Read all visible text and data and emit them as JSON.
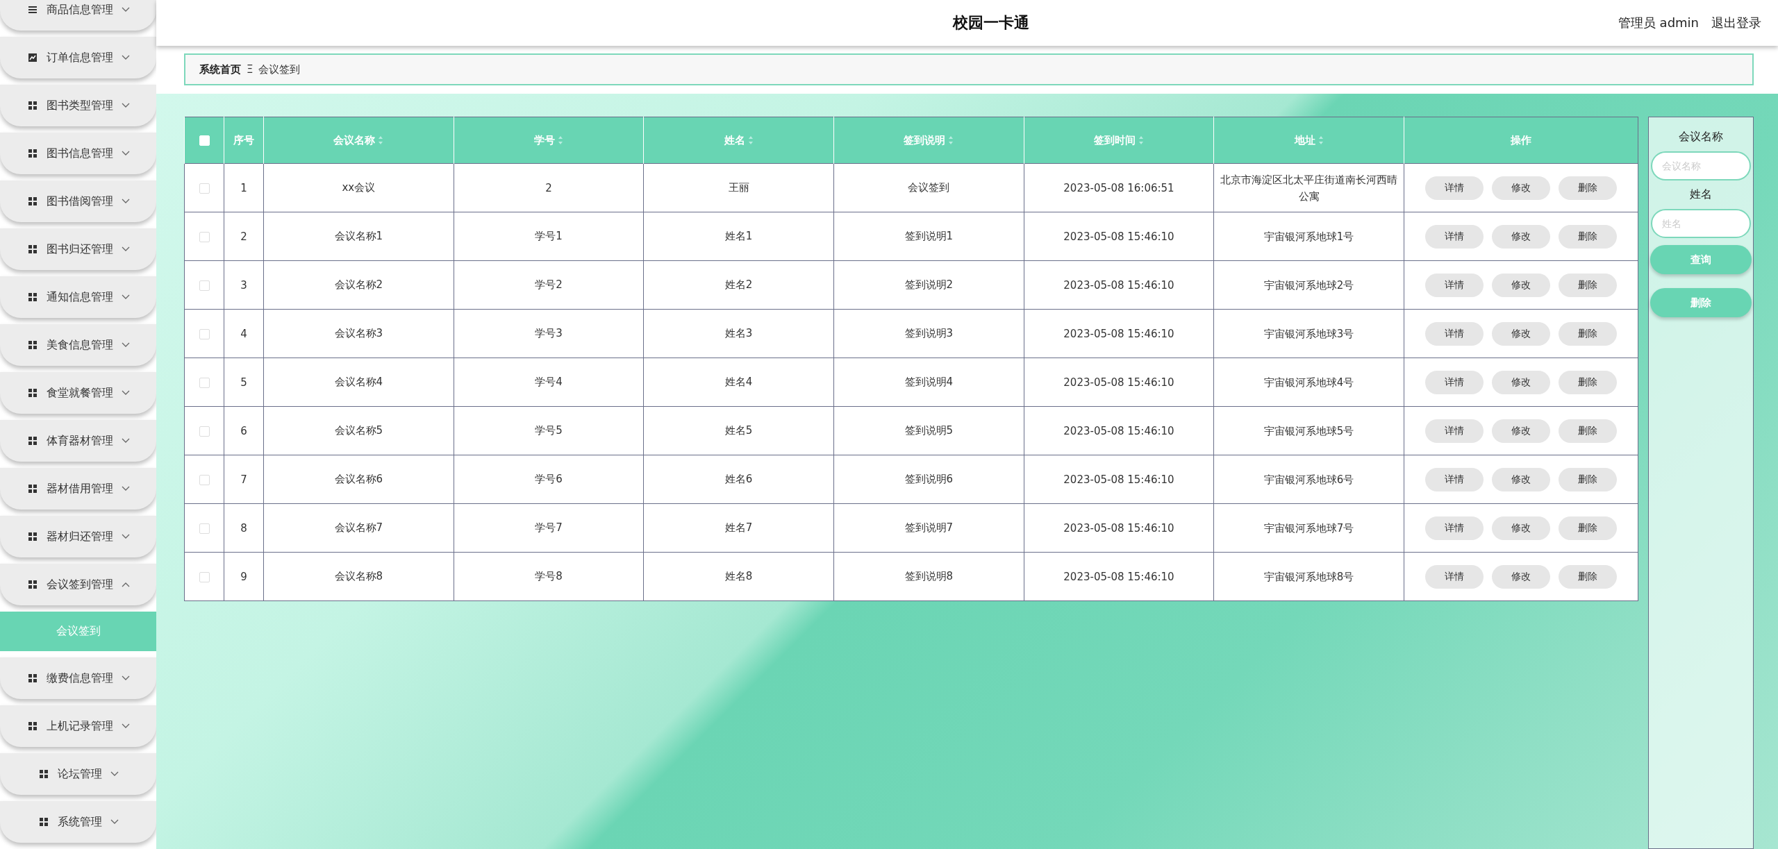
{
  "sidebar": {
    "items": [
      {
        "label": "商品信息管理",
        "expanded": false
      },
      {
        "label": "订单信息管理",
        "expanded": false
      },
      {
        "label": "图书类型管理",
        "expanded": false
      },
      {
        "label": "图书信息管理",
        "expanded": false
      },
      {
        "label": "图书借阅管理",
        "expanded": false
      },
      {
        "label": "图书归还管理",
        "expanded": false
      },
      {
        "label": "通知信息管理",
        "expanded": false
      },
      {
        "label": "美食信息管理",
        "expanded": false
      },
      {
        "label": "食堂就餐管理",
        "expanded": false
      },
      {
        "label": "体育器材管理",
        "expanded": false
      },
      {
        "label": "器材借用管理",
        "expanded": false
      },
      {
        "label": "器材归还管理",
        "expanded": false
      },
      {
        "label": "会议签到管理",
        "expanded": true,
        "children": [
          {
            "label": "会议签到",
            "selected": true
          }
        ]
      },
      {
        "label": "缴费信息管理",
        "expanded": false
      },
      {
        "label": "上机记录管理",
        "expanded": false
      },
      {
        "label": "论坛管理",
        "expanded": false
      },
      {
        "label": "系统管理",
        "expanded": false
      }
    ]
  },
  "header": {
    "title": "校园一卡通",
    "user": "管理员 admin",
    "logout": "退出登录"
  },
  "breadcrumb": {
    "home": "系统首页",
    "separator": "Ξ",
    "current": "会议签到"
  },
  "table": {
    "select_all": {
      "checked": false
    },
    "columns": [
      {
        "label": "序号",
        "sortable": false
      },
      {
        "label": "会议名称",
        "sortable": true
      },
      {
        "label": "学号",
        "sortable": true
      },
      {
        "label": "姓名",
        "sortable": true
      },
      {
        "label": "签到说明",
        "sortable": true
      },
      {
        "label": "签到时间",
        "sortable": true
      },
      {
        "label": "地址",
        "sortable": true
      },
      {
        "label": "操作",
        "sortable": false
      }
    ],
    "rows": [
      {
        "checked": false,
        "cells": [
          "1",
          "xx会议",
          "2",
          "王丽",
          "会议签到",
          "2023-05-08 16:06:51",
          "北京市海淀区北太平庄街道南长河西晴公寓"
        ]
      },
      {
        "checked": false,
        "cells": [
          "2",
          "会议名称1",
          "学号1",
          "姓名1",
          "签到说明1",
          "2023-05-08 15:46:10",
          "宇宙银河系地球1号"
        ]
      },
      {
        "checked": false,
        "cells": [
          "3",
          "会议名称2",
          "学号2",
          "姓名2",
          "签到说明2",
          "2023-05-08 15:46:10",
          "宇宙银河系地球2号"
        ]
      },
      {
        "checked": false,
        "cells": [
          "4",
          "会议名称3",
          "学号3",
          "姓名3",
          "签到说明3",
          "2023-05-08 15:46:10",
          "宇宙银河系地球3号"
        ]
      },
      {
        "checked": false,
        "cells": [
          "5",
          "会议名称4",
          "学号4",
          "姓名4",
          "签到说明4",
          "2023-05-08 15:46:10",
          "宇宙银河系地球4号"
        ]
      },
      {
        "checked": false,
        "cells": [
          "6",
          "会议名称5",
          "学号5",
          "姓名5",
          "签到说明5",
          "2023-05-08 15:46:10",
          "宇宙银河系地球5号"
        ]
      },
      {
        "checked": false,
        "cells": [
          "7",
          "会议名称6",
          "学号6",
          "姓名6",
          "签到说明6",
          "2023-05-08 15:46:10",
          "宇宙银河系地球6号"
        ]
      },
      {
        "checked": false,
        "cells": [
          "8",
          "会议名称7",
          "学号7",
          "姓名7",
          "签到说明7",
          "2023-05-08 15:46:10",
          "宇宙银河系地球7号"
        ]
      },
      {
        "checked": false,
        "cells": [
          "9",
          "会议名称8",
          "学号8",
          "姓名8",
          "签到说明8",
          "2023-05-08 15:46:10",
          "宇宙银河系地球8号"
        ]
      }
    ],
    "row_actions": [
      [
        "详情",
        "修改",
        "删除"
      ],
      [
        "详情",
        "修改",
        "删除"
      ],
      [
        "详情",
        "修改",
        "删除"
      ],
      [
        "详情",
        "修改",
        "删除"
      ],
      [
        "详情",
        "修改",
        "删除"
      ],
      [
        "详情",
        "修改",
        "删除"
      ],
      [
        "详情",
        "修改",
        "删除"
      ],
      [
        "详情",
        "修改",
        "删除"
      ],
      [
        "详情",
        "修改",
        "删除"
      ]
    ]
  },
  "search_panel": {
    "fields": [
      {
        "label": "会议名称",
        "placeholder": "会议名称"
      },
      {
        "label": "姓名",
        "placeholder": "姓名"
      }
    ],
    "buttons": [
      "查询",
      "删除"
    ]
  }
}
